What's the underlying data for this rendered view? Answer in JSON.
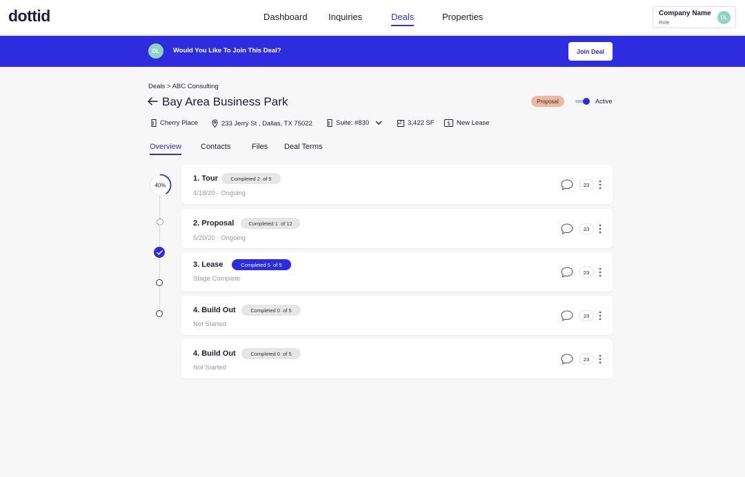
{
  "app": {
    "logo": "dottid"
  },
  "nav": {
    "items": [
      {
        "label": "Dashboard"
      },
      {
        "label": "Inquiries"
      },
      {
        "label": "Deals",
        "active": true
      },
      {
        "label": "Properties"
      }
    ]
  },
  "account": {
    "company_name": "Company Name",
    "role": "Role",
    "initials": "DL"
  },
  "banner": {
    "initials": "DL",
    "message": "Would You Like To Join This Deal?",
    "button_label": "Join Deal",
    "color": "#2d2cde"
  },
  "breadcrumb": "Deals > ABC Consulting",
  "deal": {
    "title": "Bay Area Business Park",
    "status_badge": "Proposal",
    "toggle_label": "Active",
    "toggle_on": true,
    "building": "Cherry Place",
    "address": "233 Jerry St , Dallas, TX 75022",
    "suite": "Suite: #830",
    "area": "3,422 SF",
    "lease_type": "New Lease"
  },
  "tabs": [
    {
      "label": "Overview",
      "active": true
    },
    {
      "label": "Contacts"
    },
    {
      "label": "Files"
    },
    {
      "label": "Deal Terms"
    }
  ],
  "progress": {
    "label": "40%",
    "value": 0.4
  },
  "stages": [
    {
      "name": "1. Tour",
      "badge": "Completed 2  of 5",
      "subtitle": "4/18/20 - Ongoing",
      "comments": "23",
      "complete": false
    },
    {
      "name": "2. Proposal",
      "badge": "Completed 1  of 12",
      "subtitle": "5/20/20 - Ongoing",
      "comments": "23",
      "complete": false
    },
    {
      "name": "3. Lease",
      "badge": "Completed 5  of 5",
      "subtitle": "Stage Complete",
      "comments": "23",
      "complete": true
    },
    {
      "name": "4. Build Out",
      "badge": "Completed 0  of 5",
      "subtitle": "Not Started",
      "comments": "23",
      "complete": false
    },
    {
      "name": "4. Build Out",
      "badge": "Completed 0  of 5",
      "subtitle": "Not Started",
      "comments": "23",
      "complete": false
    }
  ],
  "colors": {
    "accent": "#2d2cde",
    "proposal_badge": "#efb7a3",
    "avatar": "#8fd3c4"
  }
}
